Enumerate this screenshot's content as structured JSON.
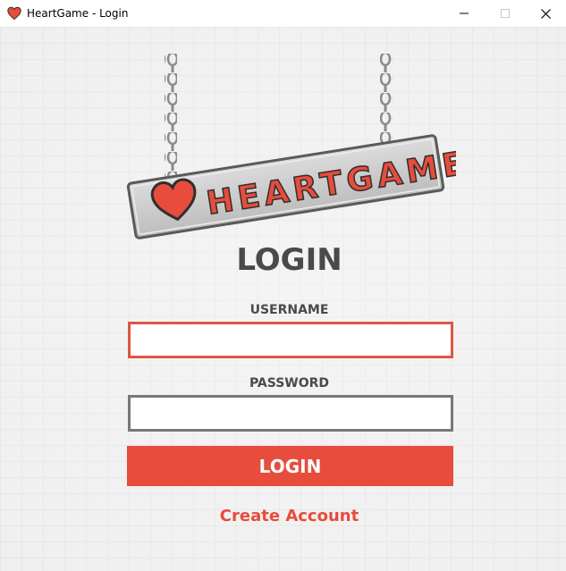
{
  "window": {
    "title": "HeartGame - Login",
    "controls": {
      "minimize": "minimize-icon",
      "maximize": "maximize-icon",
      "close": "close-icon"
    }
  },
  "logo": {
    "text": "HEARTGAME",
    "icon": "heart-icon"
  },
  "login": {
    "heading": "LOGIN",
    "username_label": "USERNAME",
    "username_value": "",
    "password_label": "PASSWORD",
    "password_value": "",
    "submit_label": "LOGIN",
    "create_account_label": "Create Account"
  },
  "colors": {
    "accent": "#e74c3c",
    "text_dark": "#4a4a4a",
    "focused_border": "#e05444",
    "input_border": "#777777",
    "background": "#efefef"
  }
}
